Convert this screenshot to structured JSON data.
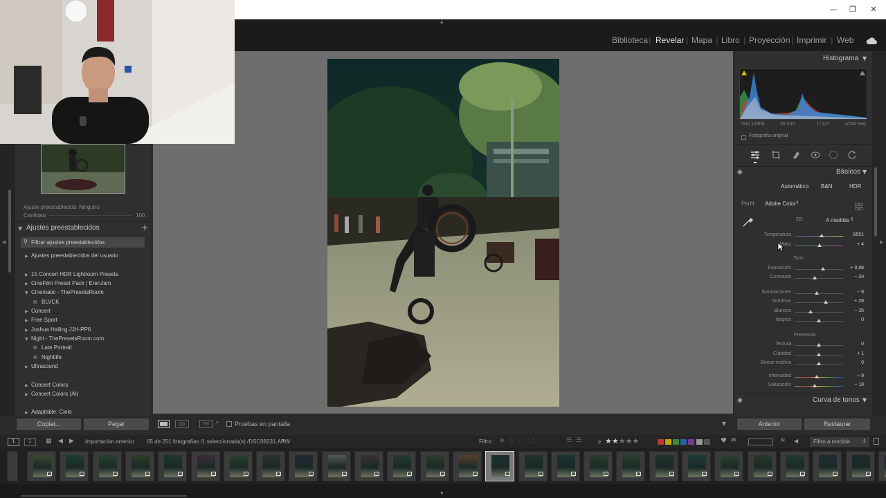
{
  "window": {
    "minimize": "—",
    "restore": "❐",
    "close": "✕"
  },
  "modules": {
    "items": [
      "Biblioteca",
      "Revelar",
      "Mapa",
      "Libro",
      "Proyección",
      "Imprimir",
      "Web"
    ],
    "active": "Revelar"
  },
  "left_panel": {
    "preset_line": "Ajuste preestablecido",
    "preset_value": "Ninguno",
    "amount_label": "Cantidad",
    "amount_value": "100",
    "section_title": "Ajustes preestablecidos",
    "add_symbol": "+",
    "filter_placeholder": "Filtrar ajustes preestablecidos",
    "items": [
      {
        "label": "Ajustes preestablecidos del usuario",
        "type": "folder"
      },
      {
        "label": "15 Concert HDR Lightroom Presets",
        "type": "folder"
      },
      {
        "label": "CineFilm Preset Pack | ErenJam",
        "type": "folder"
      },
      {
        "label": "Cinematic - ThePresetsRoom",
        "type": "folder-open"
      },
      {
        "label": "BLVCK",
        "type": "preset"
      },
      {
        "label": "Concert",
        "type": "folder"
      },
      {
        "label": "Free Sport",
        "type": "folder"
      },
      {
        "label": "Joshua Halling JJH-PP6",
        "type": "folder"
      },
      {
        "label": "Night - ThePresetsRoom.com",
        "type": "folder-open"
      },
      {
        "label": "Late Portrait",
        "type": "preset"
      },
      {
        "label": "Nightlife",
        "type": "preset"
      },
      {
        "label": "Ultrasound",
        "type": "folder"
      },
      {
        "label": "Concert Colors",
        "type": "folder"
      },
      {
        "label": "Concert Colors (AI)",
        "type": "folder"
      },
      {
        "label": "Adaptable: Cielo",
        "type": "folder"
      }
    ],
    "copy_button": "Copiar...",
    "paste_button": "Pegar"
  },
  "right_panel": {
    "histogram_title": "Histograma",
    "histogram_info": [
      "ISO 12800",
      "26 mm",
      "f / 4,0",
      "1/160 seg."
    ],
    "original_photo_label": "Fotografía original",
    "basics_title": "Básicos",
    "tabs": [
      "Automático",
      "B&N",
      "HDR"
    ],
    "profile_label": "Perfil:",
    "profile_value": "Adobe Color",
    "wb_label": "EB:",
    "wb_value": "A medida",
    "tone_title": "Tono",
    "presence_title": "Presencia",
    "sliders": [
      {
        "label": "Temperatura",
        "value": "6551",
        "level": 0.55
      },
      {
        "label": "Matiz",
        "value": "+ 4",
        "level": 0.52
      },
      {
        "label": "Exposición",
        "value": "+ 0,98",
        "level": 0.58
      },
      {
        "label": "Contraste",
        "value": "− 20",
        "level": 0.42
      },
      {
        "label": "Iluminaciones",
        "value": "− 8",
        "level": 0.46
      },
      {
        "label": "Sombras",
        "value": "+ 28",
        "level": 0.64
      },
      {
        "label": "Blancos",
        "value": "− 35",
        "level": 0.33
      },
      {
        "label": "Negros",
        "value": "0",
        "level": 0.5
      },
      {
        "label": "Textura",
        "value": "0",
        "level": 0.5
      },
      {
        "label": "Claridad",
        "value": "+ 1",
        "level": 0.505
      },
      {
        "label": "Borrar neblina",
        "value": "0",
        "level": 0.5
      },
      {
        "label": "Intensidad",
        "value": "− 9",
        "level": 0.455
      },
      {
        "label": "Saturación",
        "value": "− 18",
        "level": 0.41
      }
    ],
    "tone_curve_title": "Curva de tonos",
    "previous_button": "Anterior",
    "reset_button": "Restaurar"
  },
  "toolbar": {
    "soft_proof_label": "Pruebas en pantalla"
  },
  "filmstrip_bar": {
    "view1": "1",
    "view2": "2",
    "source": "Importación anterior",
    "count_text": "65 de 251 fotografías /1 seleccionada(s) /DSC08231.ARW",
    "filter_label": "Filtro :",
    "stars_operator": "≥",
    "filter_dropdown": "Filtro a medida"
  },
  "filmstrip": {
    "thumb_colors": [
      "#3a4a2f",
      "#1f3a33",
      "#25402e",
      "#2f3d27",
      "#1e3530",
      "#3d2a38",
      "#2a4030",
      "#2f2f2a",
      "#222a35",
      "#555555",
      "#3a3030",
      "#263a2e",
      "#2f3a28",
      "#5a4030",
      "#1e2e2c",
      "#23302a",
      "#1b3134",
      "#2a3a30",
      "#28402e",
      "#20302c",
      "#1d3a36",
      "#2e4032",
      "#27392c",
      "#22392e",
      "#1e2c33",
      "#1b2a2d",
      "#1c2a30"
    ],
    "selected_index": 14
  },
  "colors": {
    "accent_white": "#e8e8e8",
    "histogram_blue": "#3b82d6",
    "histogram_green": "#3c9a4a",
    "histogram_red": "#c0453a"
  }
}
